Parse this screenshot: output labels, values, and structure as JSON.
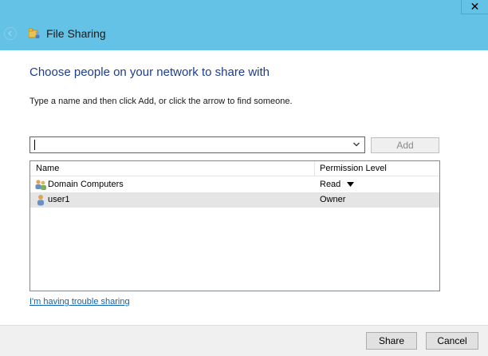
{
  "window": {
    "title": "File Sharing",
    "close_glyph": "✕",
    "close_icon": "close-icon",
    "back_icon": "back-arrow-icon",
    "app_icon": "file-sharing-icon"
  },
  "main": {
    "heading": "Choose people on your network to share with",
    "instruction": "Type a name and then click Add, or click the arrow to find someone.",
    "name_input_value": "",
    "add_label": "Add"
  },
  "list": {
    "columns": [
      "Name",
      "Permission Level"
    ],
    "rows": [
      {
        "name": "Domain Computers",
        "permission": "Read",
        "icon": "group-icon",
        "has_dropdown": true
      },
      {
        "name": "user1",
        "permission": "Owner",
        "icon": "user-icon",
        "has_dropdown": false,
        "selected": true
      }
    ]
  },
  "trouble_link": "I'm having trouble sharing",
  "footer": {
    "share_label": "Share",
    "cancel_label": "Cancel"
  },
  "colors": {
    "titlebar": "#63c2e6",
    "heading": "#1e3d8f",
    "link": "#0b64b2",
    "selected_row": "#e5e5e5"
  }
}
